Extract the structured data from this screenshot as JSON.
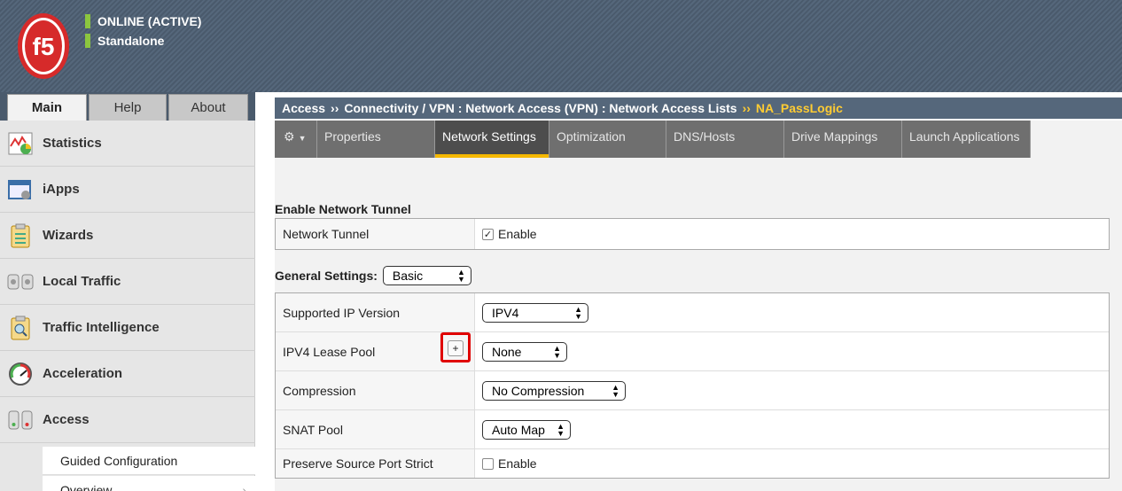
{
  "header": {
    "logo_text": "f5",
    "status_lines": [
      "ONLINE (ACTIVE)",
      "Standalone"
    ]
  },
  "nav_tabs": [
    {
      "label": "Main",
      "active": true
    },
    {
      "label": "Help",
      "active": false
    },
    {
      "label": "About",
      "active": false
    }
  ],
  "sidebar": {
    "items": [
      {
        "label": "Statistics",
        "icon": "statistics-icon"
      },
      {
        "label": "iApps",
        "icon": "iapps-icon"
      },
      {
        "label": "Wizards",
        "icon": "wizards-icon"
      },
      {
        "label": "Local Traffic",
        "icon": "local-traffic-icon"
      },
      {
        "label": "Traffic Intelligence",
        "icon": "traffic-intelligence-icon"
      },
      {
        "label": "Acceleration",
        "icon": "acceleration-icon"
      },
      {
        "label": "Access",
        "icon": "access-icon"
      }
    ],
    "sub_items": [
      {
        "label": "Guided Configuration"
      },
      {
        "label": "Overview"
      }
    ]
  },
  "breadcrumb": {
    "parts": [
      "Access",
      "Connectivity / VPN : Network Access (VPN) : Network Access Lists"
    ],
    "separator": "››",
    "current": "NA_PassLogic"
  },
  "tabs": [
    {
      "label": "Properties",
      "active": false
    },
    {
      "label": "Network Settings",
      "active": true
    },
    {
      "label": "Optimization",
      "active": false
    },
    {
      "label": "DNS/Hosts",
      "active": false
    },
    {
      "label": "Drive Mappings",
      "active": false
    },
    {
      "label": "Launch Applications",
      "active": false
    }
  ],
  "network_tunnel": {
    "section_title": "Enable Network Tunnel",
    "label": "Network Tunnel",
    "checkbox_label": "Enable",
    "checked": true
  },
  "general_settings": {
    "label": "General Settings:",
    "mode": "Basic",
    "rows": {
      "supported_ip": {
        "label": "Supported IP Version",
        "value": "IPV4"
      },
      "lease_pool": {
        "label": "IPV4 Lease Pool",
        "value": "None",
        "add_label": "+"
      },
      "compression": {
        "label": "Compression",
        "value": "No Compression"
      },
      "snat_pool": {
        "label": "SNAT Pool",
        "value": "Auto Map"
      },
      "preserve_port": {
        "label": "Preserve Source Port Strict",
        "checkbox_label": "Enable",
        "checked": false
      }
    }
  },
  "colors": {
    "accent": "#f5b800",
    "status_green": "#8cc63f",
    "highlight_red": "#e00000"
  }
}
